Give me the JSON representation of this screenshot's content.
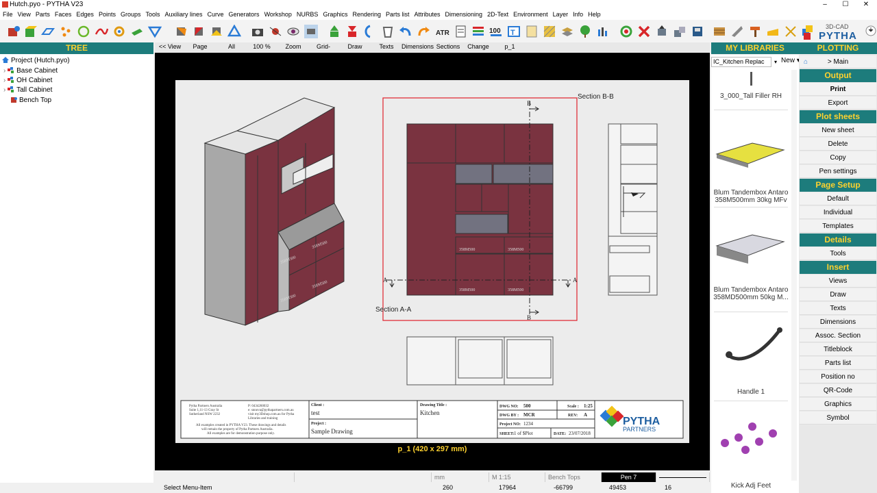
{
  "window": {
    "title": "Hutch.pyo - PYTHA V23",
    "minimize": "–",
    "maximize": "☐",
    "close": "✕"
  },
  "menu": [
    "File",
    "View",
    "Parts",
    "Faces",
    "Edges",
    "Points",
    "Groups",
    "Tools",
    "Auxiliary lines",
    "Curve",
    "Generators",
    "Workshop",
    "NURBS",
    "Graphics",
    "Rendering",
    "Parts list",
    "Attributes",
    "Dimensioning",
    "2D-Text",
    "Environment",
    "Layer",
    "Info",
    "Help"
  ],
  "logo": {
    "small": "3D-CAD",
    "big": "PYTHA"
  },
  "tree": {
    "header": "TREE",
    "project": "Project (Hutch.pyo)",
    "items": [
      "Base Cabinet",
      "OH Cabinet",
      "Tall Cabinet",
      "Bench Top"
    ]
  },
  "viewbar": [
    "<< View",
    "Page",
    "All",
    "100 %",
    "Zoom",
    "Grid-",
    "Draw",
    "Texts",
    "Dimensions",
    "Sections",
    "Change",
    "p_1"
  ],
  "drawing": {
    "section_bb": "Section B-B",
    "section_aa": "Section A-A",
    "mark_a": "A",
    "mark_b": "B",
    "drawer_labels": [
      "358M500",
      "358M500",
      "358M500",
      "358M500"
    ],
    "titleblock": {
      "company": [
        "Pytha Partners Australia",
        "Suite 1,11-13 Gray St",
        "Sutherland NSW 2232"
      ],
      "contact": [
        "P: 0434260032",
        "e: snnova@pythapartners.com.au",
        "visit my3Dshop.com.au for Pytha",
        "Libraries and training"
      ],
      "disclaimer": [
        "All examples created in PYTHA V23. These drawings and details",
        "will remain the property of Pytha Partners Australia.",
        "All examples are for demonstration purpose only."
      ],
      "client_label": "Client :",
      "client": "test",
      "project_label": "Project :",
      "project": "Sample Drawing",
      "drawing_title_label": "Drawing Title :",
      "drawing_title": "Kitchen",
      "dwg_no_label": "DWG NO:",
      "dwg_no": "500",
      "scale_label": "Scale :",
      "scale": "1:25",
      "dwg_by_label": "DWG BY :",
      "dwg_by": "MCR",
      "rev_label": "REV:",
      "rev": "A",
      "project_no_label": "Project NO:",
      "project_no": "1234",
      "sheet_label": "SHEET:",
      "sheet": "1 of $Plot",
      "date_label": "DATE:",
      "date": "23/07/2018",
      "logo_main": "PYTHA",
      "logo_sub": "PARTNERS"
    }
  },
  "sheet_label": "p_1 (420 x 297 mm)",
  "statusbar": {
    "unit": "mm",
    "scale": "M 1:15",
    "layer": "Bench Tops",
    "pen": "Pen 7"
  },
  "bottombar": {
    "hint": "Select Menu-Item",
    "c1": "260",
    "c2": "17964",
    "c3": "-66799",
    "c4": "49453",
    "c5": "16"
  },
  "libraries": {
    "header": "MY LIBRARIES",
    "dropdown": "IC_Kitchen Replac",
    "new_label": "New",
    "items": [
      "3_000_Tall Filler RH",
      "Blum Tandembox Antaro 358M500mm 30kg MFv",
      "Blum Tandembox Antaro 358MD500mm 50kg M...",
      "Handle 1",
      "Kick Adj Feet"
    ]
  },
  "plotting": {
    "header": "PLOTTING",
    "main": "> Main",
    "sections": [
      {
        "header": "Output",
        "buttons": [
          "Print",
          "Export"
        ]
      },
      {
        "header": "Plot sheets",
        "buttons": [
          "New sheet",
          "Delete",
          "Copy",
          "Pen settings"
        ]
      },
      {
        "header": "Page Setup",
        "buttons": [
          "Default",
          "Individual",
          "Templates"
        ]
      },
      {
        "header": "Details",
        "buttons": [
          "Tools"
        ]
      },
      {
        "header": "Insert",
        "buttons": [
          "Views",
          "Draw",
          "Texts",
          "Dimensions",
          "Assoc. Section",
          "Titleblock",
          "Parts list",
          "Position no",
          "QR-Code",
          "Graphics",
          "Symbol"
        ]
      }
    ]
  },
  "colors": {
    "panel_header": "#1d7c7c",
    "header_text": "#ffd22e",
    "carcass": "#7a3340",
    "section_red": "#e0202a"
  }
}
